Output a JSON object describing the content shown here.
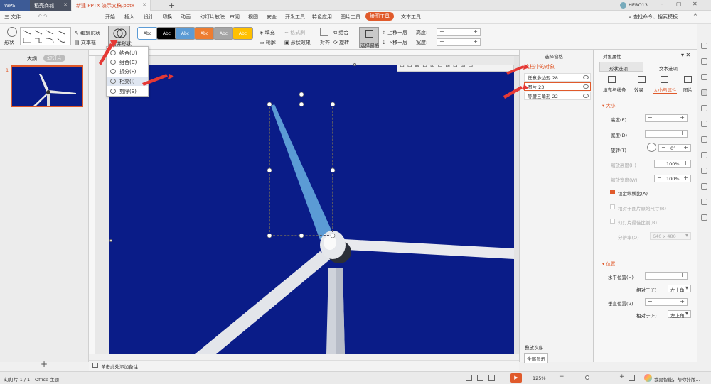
{
  "titlebar": {
    "tabs": [
      {
        "label": "WPS"
      },
      {
        "label": "稻壳商城"
      },
      {
        "label": "新建 PPTX 演示文稿.pptx"
      }
    ],
    "user": "HERO13...",
    "add_tab": "+"
  },
  "menubar": {
    "file": "三 文件",
    "items": [
      "开始",
      "插入",
      "设计",
      "切换",
      "动画",
      "幻灯片放映",
      "审阅",
      "视图",
      "安全",
      "开发工具",
      "特色应用",
      "图片工具",
      "绘图工具",
      "文本工具"
    ],
    "active": "绘图工具",
    "search": "查找命令、搜索模板"
  },
  "ribbon": {
    "shape_label": "形状",
    "edit_shape": "编辑形状",
    "text_box": "文本框",
    "merge_shape": "合并形状",
    "style_samples": [
      "Abc",
      "Abc",
      "Abc",
      "Abc",
      "Abc",
      "Abc"
    ],
    "style_colors": [
      "#ffffff",
      "#000000",
      "#5b9bd5",
      "#ed7d31",
      "#a5a5a5",
      "#ffc000"
    ],
    "fill": "填充",
    "format_painter": "格式刷",
    "outline": "轮廓",
    "shape_effects": "形状效果",
    "align": "对齐",
    "group": "组合",
    "rotate": "旋转",
    "selection_pane": "选择窗格",
    "bring_forward": "上移一层",
    "send_backward": "下移一层",
    "height": "高度:",
    "width": "宽度:"
  },
  "merge_menu": {
    "items": [
      "结合(U)",
      "组合(C)",
      "拆分(F)",
      "相交(I)",
      "剪除(S)"
    ],
    "highlighted": "相交(I)"
  },
  "left_panel": {
    "tab_outline": "大纲",
    "tab_slides": "幻灯片",
    "slide_number": "1",
    "add_slide": "+"
  },
  "selection_pane": {
    "title": "选择窗格",
    "section": "文档中的对象",
    "objects": [
      "任意多边形 28",
      "图片 23",
      "等腰三角形 22"
    ],
    "order_label": "叠放次序",
    "show_all": "全部显示"
  },
  "property_pane": {
    "title": "对象属性",
    "tabs": [
      "形状选项",
      "文本选项"
    ],
    "subtabs": [
      "填充与线条",
      "效果",
      "大小与属性",
      "图片"
    ],
    "active_subtab": "大小与属性",
    "size_section": "大小",
    "height": "高度(E)",
    "width": "宽度(D)",
    "rotation": "旋转(T)",
    "rotation_value": "0°",
    "scale_height": "缩放高度(H)",
    "scale_height_value": "100%",
    "scale_width": "缩放宽度(W)",
    "scale_width_value": "100%",
    "lock_ratio": "锁定纵横比(A)",
    "relative_original": "相对于图片原始尺寸(R)",
    "best_scale": "幻灯片最佳比例(B)",
    "resolution": "分辨率(O)",
    "resolution_value": "640 x 480",
    "position_section": "位置",
    "h_pos": "水平位置(H)",
    "h_relative": "相对于(F)",
    "h_relative_value": "左上角",
    "v_pos": "垂直位置(V)",
    "v_relative": "相对于(E)",
    "v_relative_value": "左上角"
  },
  "notes": {
    "placeholder": "单击此处添加备注"
  },
  "status": {
    "slide_info": "幻灯片 1 / 1",
    "theme": "Office 主题",
    "zoom": "125%",
    "assistant": "我是智能，帮你排版..."
  },
  "colors": {
    "accent": "#e05a2b",
    "slide_bg": "#0a1c88",
    "highlight_blade": "#5b9bd5"
  }
}
